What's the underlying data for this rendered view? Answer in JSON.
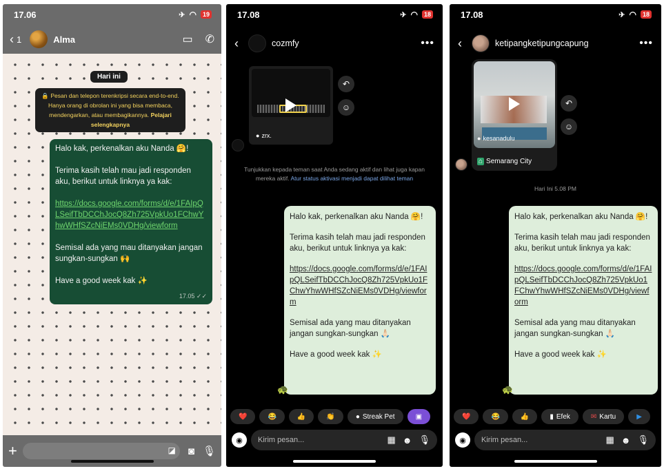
{
  "whatsapp": {
    "time": "17.06",
    "battery": "19",
    "back_count": "1",
    "contact_name": "Alma",
    "day_label": "Hari ini",
    "encryption_text": "Pesan dan telepon terenkripsi secara end-to-end. Hanya orang di obrolan ini yang bisa membaca, mendengarkan, atau membagikannya.",
    "encryption_link": "Pelajari selengkapnya",
    "message": {
      "greeting": "Halo kak, perkenalkan aku Nanda 🤗!",
      "thanks": "Terima kasih telah mau jadi responden aku, berikut untuk linknya ya kak:",
      "url": "https://docs.google.com/forms/d/e/1FAIpQLSeifTbDCChJocQ8Zh725VpkUo1FChwYhwWHfSZcNiEMs0VDHg/viewform",
      "ask": "Semisal ada yang mau ditanyakan jangan sungkan-sungkan 🙌",
      "closing": "Have a good week kak ✨",
      "time": "17.05 ✓✓"
    }
  },
  "ig1": {
    "time": "17.08",
    "battery": "18",
    "username": "cozmfy",
    "reel_caption": "zrx.",
    "activity_hint": "Tunjukkan kepada teman saat Anda sedang aktif dan lihat juga kapan mereka aktif.",
    "activity_link": "Atur status aktivasi menjadi dapat dilihat teman",
    "chips": [
      "❤️",
      "😂",
      "👍",
      "👏",
      "Streak Pet"
    ],
    "input_placeholder": "Kirim pesan..."
  },
  "ig2": {
    "time": "17.08",
    "battery": "18",
    "username": "ketipangketipungcapung",
    "reel_account": "kesanadulu",
    "location": "Semarang City",
    "timestamp": "Hari Ini 5.08 PM",
    "chips": [
      "❤️",
      "😂",
      "👍",
      "Efek",
      "Kartu"
    ],
    "input_placeholder": "Kirim pesan..."
  },
  "shared_message": {
    "greeting": "Halo kak, perkenalkan aku Nanda 🤗!",
    "thanks": "Terima kasih telah mau jadi responden aku, berikut untuk linknya ya kak:",
    "url": "https://docs.google.com/forms/d/e/1FAIpQLSeifTbDCChJocQ8Zh725VpkUo1FChwYhwWHfSZcNiEMs0VDHg/viewform",
    "ask": "Semisal ada yang mau ditanyakan jangan sungkan-sungkan 🙏🏻",
    "closing": "Have a good week kak ✨"
  }
}
